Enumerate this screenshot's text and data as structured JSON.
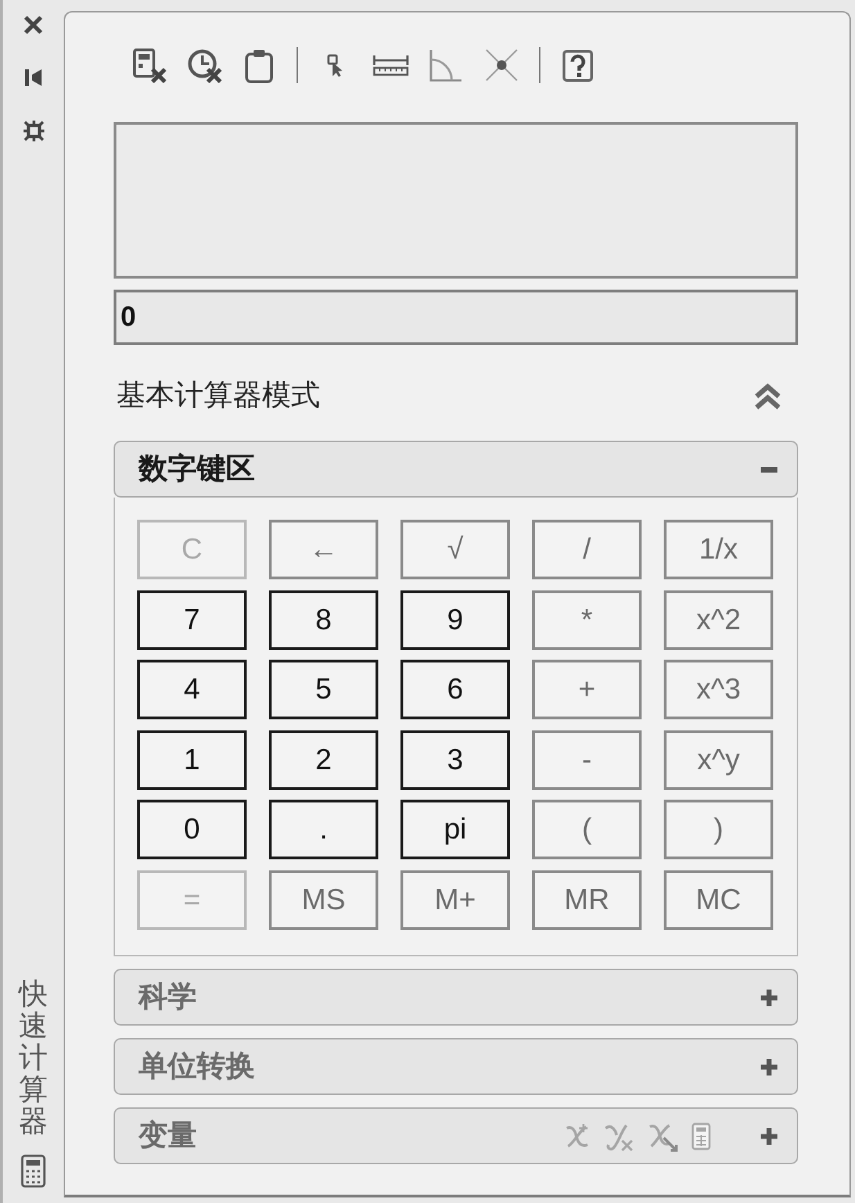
{
  "sidebar": {
    "title": "快速计算器"
  },
  "display": {
    "value": "0"
  },
  "mode": {
    "label": "基本计算器模式",
    "expanded": true
  },
  "panels": [
    {
      "title": "数字键区",
      "kind": "keypad",
      "expanded": true,
      "keys": [
        {
          "label": "C",
          "kind": "function",
          "disabled": true
        },
        {
          "label": "←",
          "kind": "function",
          "disabled": false
        },
        {
          "label": "√",
          "kind": "function",
          "disabled": false
        },
        {
          "label": "/",
          "kind": "function",
          "disabled": false
        },
        {
          "label": "1/x",
          "kind": "function",
          "disabled": false
        },
        {
          "label": "7",
          "kind": "digit",
          "disabled": false
        },
        {
          "label": "8",
          "kind": "digit",
          "disabled": false
        },
        {
          "label": "9",
          "kind": "digit",
          "disabled": false
        },
        {
          "label": "*",
          "kind": "function",
          "disabled": false
        },
        {
          "label": "x^2",
          "kind": "function",
          "disabled": false
        },
        {
          "label": "4",
          "kind": "digit",
          "disabled": false
        },
        {
          "label": "5",
          "kind": "digit",
          "disabled": false
        },
        {
          "label": "6",
          "kind": "digit",
          "disabled": false
        },
        {
          "label": "+",
          "kind": "function",
          "disabled": false
        },
        {
          "label": "x^3",
          "kind": "function",
          "disabled": false
        },
        {
          "label": "1",
          "kind": "digit",
          "disabled": false
        },
        {
          "label": "2",
          "kind": "digit",
          "disabled": false
        },
        {
          "label": "3",
          "kind": "digit",
          "disabled": false
        },
        {
          "label": "-",
          "kind": "function",
          "disabled": false
        },
        {
          "label": "x^y",
          "kind": "function",
          "disabled": false
        },
        {
          "label": "0",
          "kind": "digit",
          "disabled": false
        },
        {
          "label": ".",
          "kind": "digit",
          "disabled": false
        },
        {
          "label": "pi",
          "kind": "digit",
          "disabled": false
        },
        {
          "label": "(",
          "kind": "function",
          "disabled": false
        },
        {
          "label": ")",
          "kind": "function",
          "disabled": false
        },
        {
          "label": "=",
          "kind": "function",
          "disabled": true
        },
        {
          "label": "MS",
          "kind": "function",
          "disabled": false
        },
        {
          "label": "M+",
          "kind": "function",
          "disabled": false
        },
        {
          "label": "MR",
          "kind": "function",
          "disabled": false
        },
        {
          "label": "MC",
          "kind": "function",
          "disabled": false
        }
      ]
    },
    {
      "title": "科学",
      "kind": "section",
      "expanded": false
    },
    {
      "title": "单位转换",
      "kind": "section",
      "expanded": false
    },
    {
      "title": "变量",
      "kind": "variables",
      "expanded": false
    }
  ]
}
